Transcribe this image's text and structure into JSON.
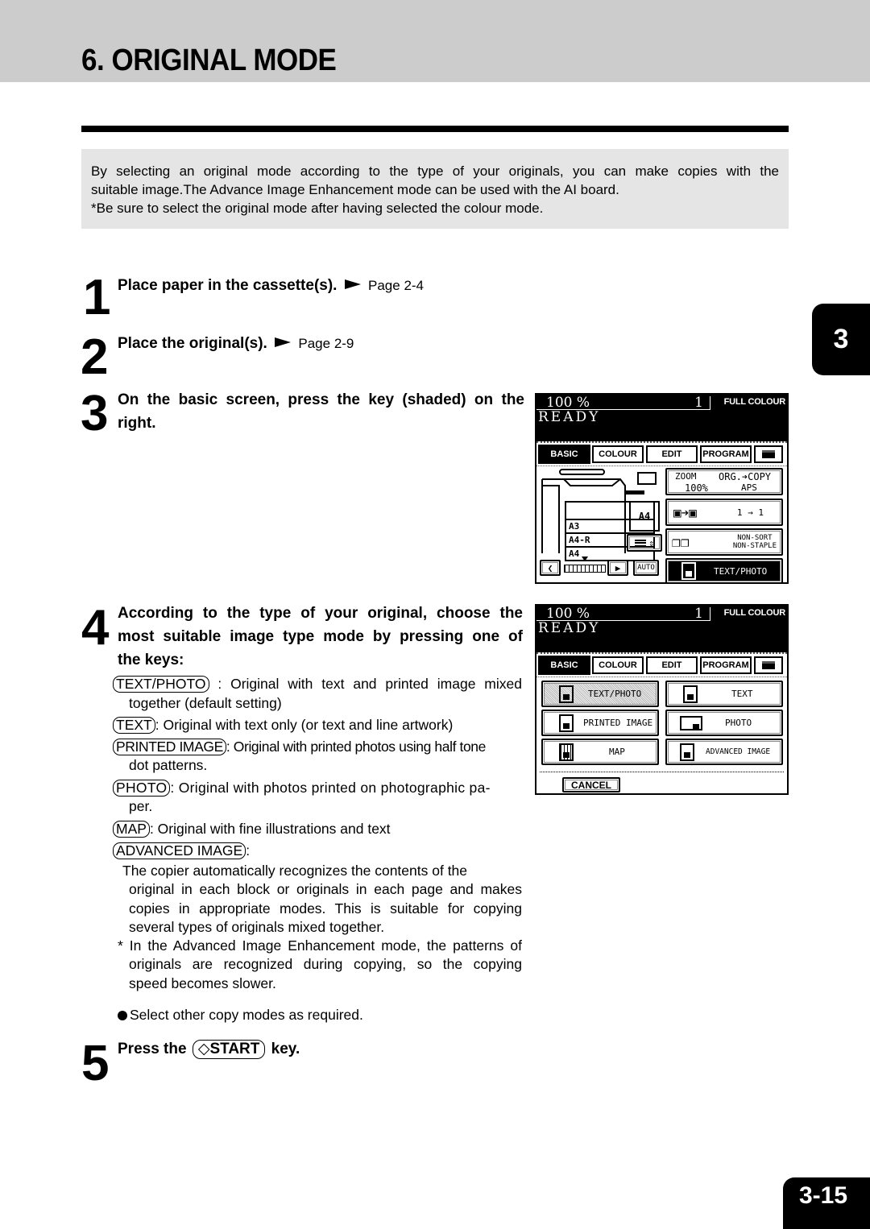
{
  "page": {
    "title": "6. ORIGINAL MODE",
    "chapter_tab": "3",
    "page_number": "3-15"
  },
  "intro": {
    "line1": "By selecting an original mode according to the type of your originals, you can make copies with the",
    "line2": "suitable image.The Advance Image Enhancement mode can be used with the AI board.",
    "line3": "*Be sure to select the original mode after having selected the colour mode."
  },
  "steps": [
    {
      "num": "1",
      "text": "Place paper in the cassette(s).",
      "page_ref": "Page 2-4"
    },
    {
      "num": "2",
      "text": "Place the original(s).",
      "page_ref": "Page 2-9"
    },
    {
      "num": "3",
      "line1": "On the basic screen, press the key (shaded) on the",
      "line2": "right."
    },
    {
      "num": "4",
      "line1": "According to the type of your original, choose the",
      "line2": "most suitable image type mode by pressing one of",
      "line3": "the  keys:"
    },
    {
      "num": "5",
      "pre": "Press the",
      "key": "START",
      "post": "key."
    }
  ],
  "key_definitions": [
    {
      "key": "TEXT/PHOTO",
      "line1": " : Original with text and printed image mixed",
      "line2": "together (default setting)"
    },
    {
      "key": "TEXT",
      "line1": ": Original with text only (or text and line artwork)"
    },
    {
      "key": "PRINTED IMAGE",
      "line1": ": Original with printed photos using half tone",
      "line2": "dot patterns."
    },
    {
      "key": "PHOTO",
      "line1": ": Original with photos printed on photographic pa-",
      "line2": "per."
    },
    {
      "key": "MAP",
      "line1": ": Original with fine illustrations and text"
    },
    {
      "key": "ADVANCED IMAGE",
      "line1": ":"
    }
  ],
  "advanced_description": {
    "lines": [
      "The copier automatically recognizes the contents of the",
      "original in each block or originals in each page and makes",
      "copies in appropriate modes. This is suitable for copying",
      "several types of originals mixed together."
    ],
    "note_lines": [
      "* In the Advanced Image Enhancement mode, the patterns of",
      "originals are recognized during copying, so the copying",
      "speed becomes slower."
    ]
  },
  "bullet_note": "Select other copy modes as required.",
  "lcd_basic": {
    "zoom": "100  %",
    "count": "1",
    "colour_mode": "FULL COLOUR",
    "status": "READY",
    "tabs": [
      "BASIC",
      "COLOUR",
      "EDIT",
      "PROGRAM"
    ],
    "active_tab": "BASIC",
    "zoom_button": {
      "label": "ZOOM",
      "value": "100%",
      "org_copy": "ORG.➔COPY",
      "aps": "APS"
    },
    "duplex_button": "1 → 1",
    "finisher_button": {
      "line1": "NON-SORT",
      "line2": "NON-STAPLE"
    },
    "original_mode_button": "TEXT/PHOTO",
    "trays": [
      "",
      "A3",
      "A4-R",
      "A4"
    ],
    "bypass_paper": "A4",
    "density_auto": "AUTO",
    "density_level": 0.5
  },
  "lcd_modes": {
    "zoom": "100  %",
    "count": "1",
    "colour_mode": "FULL COLOUR",
    "status": "READY",
    "tabs": [
      "BASIC",
      "COLOUR",
      "EDIT",
      "PROGRAM"
    ],
    "active_tab": "BASIC",
    "mode_buttons": [
      "TEXT/PHOTO",
      "TEXT",
      "PRINTED IMAGE",
      "PHOTO",
      "MAP",
      "ADVANCED IMAGE"
    ],
    "selected_mode": "TEXT/PHOTO",
    "cancel": "CANCEL"
  }
}
